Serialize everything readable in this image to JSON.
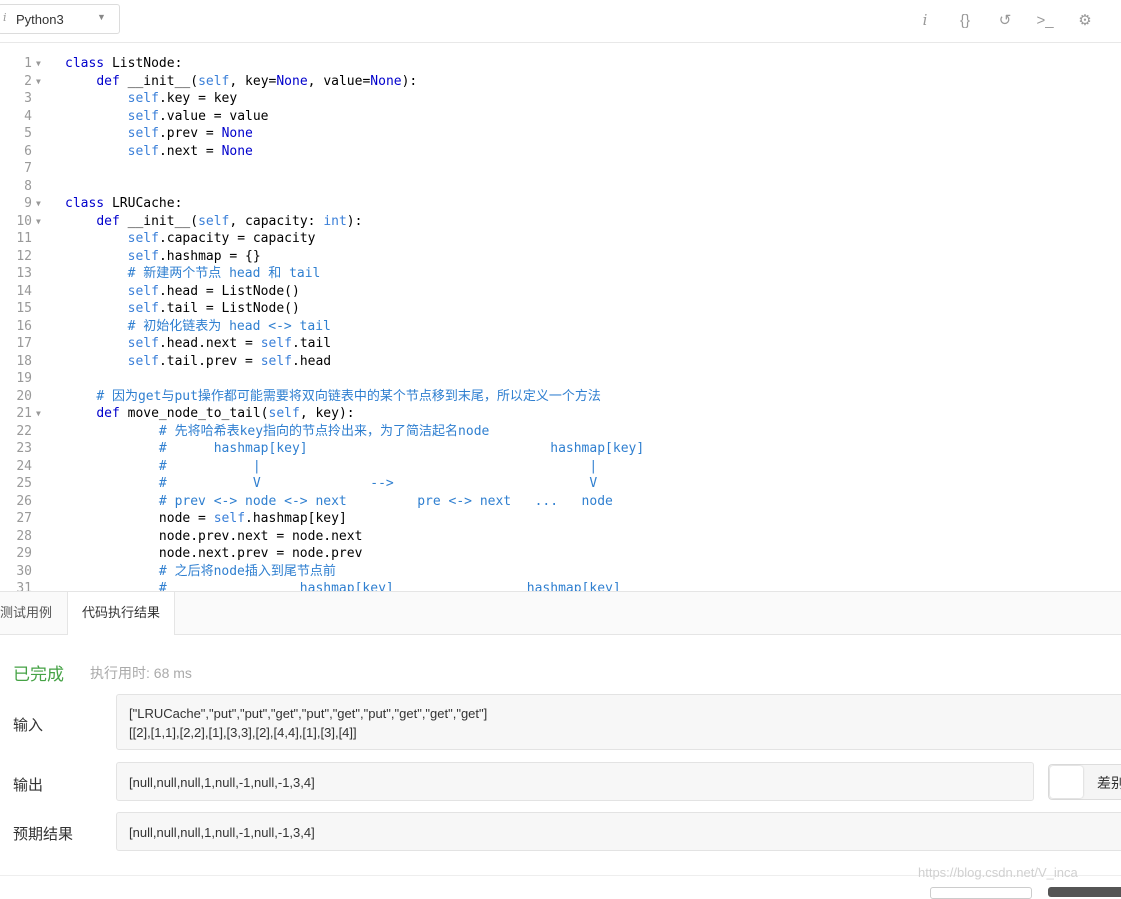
{
  "toolbar": {
    "language": "Python3",
    "icons": [
      "info-icon",
      "braces-icon",
      "reset-icon",
      "console-icon",
      "settings-icon"
    ],
    "icon_glyphs": [
      "i",
      "{}",
      "↺",
      ">_",
      "⚙"
    ]
  },
  "editor": {
    "lines": [
      {
        "n": "1",
        "fold": true,
        "t": [
          [
            "kw",
            "class"
          ],
          [
            "n",
            " ListNode:"
          ]
        ]
      },
      {
        "n": "2",
        "fold": true,
        "t": [
          [
            "n",
            "    "
          ],
          [
            "kw",
            "def"
          ],
          [
            "n",
            " __init__("
          ],
          [
            "sf",
            "self"
          ],
          [
            "n",
            ", key="
          ],
          [
            "kw",
            "None"
          ],
          [
            "n",
            ", value="
          ],
          [
            "kw",
            "None"
          ],
          [
            "n",
            "):"
          ]
        ]
      },
      {
        "n": "3",
        "t": [
          [
            "n",
            "        "
          ],
          [
            "sf",
            "self"
          ],
          [
            "n",
            ".key = key"
          ]
        ]
      },
      {
        "n": "4",
        "t": [
          [
            "n",
            "        "
          ],
          [
            "sf",
            "self"
          ],
          [
            "n",
            ".value = value"
          ]
        ]
      },
      {
        "n": "5",
        "t": [
          [
            "n",
            "        "
          ],
          [
            "sf",
            "self"
          ],
          [
            "n",
            ".prev = "
          ],
          [
            "kw",
            "None"
          ]
        ]
      },
      {
        "n": "6",
        "t": [
          [
            "n",
            "        "
          ],
          [
            "sf",
            "self"
          ],
          [
            "n",
            ".next = "
          ],
          [
            "kw",
            "None"
          ]
        ]
      },
      {
        "n": "7",
        "t": []
      },
      {
        "n": "8",
        "t": []
      },
      {
        "n": "9",
        "fold": true,
        "t": [
          [
            "kw",
            "class"
          ],
          [
            "n",
            " LRUCache:"
          ]
        ]
      },
      {
        "n": "10",
        "fold": true,
        "t": [
          [
            "n",
            "    "
          ],
          [
            "kw",
            "def"
          ],
          [
            "n",
            " __init__("
          ],
          [
            "sf",
            "self"
          ],
          [
            "n",
            ", capacity: "
          ],
          [
            "sf",
            "int"
          ],
          [
            "n",
            "):"
          ]
        ]
      },
      {
        "n": "11",
        "t": [
          [
            "n",
            "        "
          ],
          [
            "sf",
            "self"
          ],
          [
            "n",
            ".capacity = capacity"
          ]
        ]
      },
      {
        "n": "12",
        "t": [
          [
            "n",
            "        "
          ],
          [
            "sf",
            "self"
          ],
          [
            "n",
            ".hashmap = {}"
          ]
        ]
      },
      {
        "n": "13",
        "t": [
          [
            "n",
            "        "
          ],
          [
            "cm",
            "# 新建两个节点 head 和 tail"
          ]
        ]
      },
      {
        "n": "14",
        "t": [
          [
            "n",
            "        "
          ],
          [
            "sf",
            "self"
          ],
          [
            "n",
            ".head = ListNode()"
          ]
        ]
      },
      {
        "n": "15",
        "t": [
          [
            "n",
            "        "
          ],
          [
            "sf",
            "self"
          ],
          [
            "n",
            ".tail = ListNode()"
          ]
        ]
      },
      {
        "n": "16",
        "t": [
          [
            "n",
            "        "
          ],
          [
            "cm",
            "# 初始化链表为 head <-> tail"
          ]
        ]
      },
      {
        "n": "17",
        "t": [
          [
            "n",
            "        "
          ],
          [
            "sf",
            "self"
          ],
          [
            "n",
            ".head.next = "
          ],
          [
            "sf",
            "self"
          ],
          [
            "n",
            ".tail"
          ]
        ]
      },
      {
        "n": "18",
        "t": [
          [
            "n",
            "        "
          ],
          [
            "sf",
            "self"
          ],
          [
            "n",
            ".tail.prev = "
          ],
          [
            "sf",
            "self"
          ],
          [
            "n",
            ".head"
          ]
        ]
      },
      {
        "n": "19",
        "t": []
      },
      {
        "n": "20",
        "t": [
          [
            "n",
            "    "
          ],
          [
            "cm",
            "# 因为get与put操作都可能需要将双向链表中的某个节点移到末尾，所以定义一个方法"
          ]
        ]
      },
      {
        "n": "21",
        "fold": true,
        "t": [
          [
            "n",
            "    "
          ],
          [
            "kw",
            "def"
          ],
          [
            "n",
            " move_node_to_tail("
          ],
          [
            "sf",
            "self"
          ],
          [
            "n",
            ", key):"
          ]
        ]
      },
      {
        "n": "22",
        "t": [
          [
            "n",
            "            "
          ],
          [
            "cm",
            "# 先将哈希表key指向的节点拎出来，为了简洁起名node"
          ]
        ]
      },
      {
        "n": "23",
        "t": [
          [
            "n",
            "            "
          ],
          [
            "cm",
            "#      hashmap[key]                               hashmap[key]"
          ]
        ]
      },
      {
        "n": "24",
        "t": [
          [
            "n",
            "            "
          ],
          [
            "cm",
            "#           |                                          |"
          ]
        ]
      },
      {
        "n": "25",
        "t": [
          [
            "n",
            "            "
          ],
          [
            "cm",
            "#           V              -->                         V"
          ]
        ]
      },
      {
        "n": "26",
        "t": [
          [
            "n",
            "            "
          ],
          [
            "cm",
            "# prev <-> node <-> next         pre <-> next   ...   node"
          ]
        ]
      },
      {
        "n": "27",
        "t": [
          [
            "n",
            "            node = "
          ],
          [
            "sf",
            "self"
          ],
          [
            "n",
            ".hashmap[key]"
          ]
        ]
      },
      {
        "n": "28",
        "t": [
          [
            "n",
            "            node.prev.next = node.next"
          ]
        ]
      },
      {
        "n": "29",
        "t": [
          [
            "n",
            "            node.next.prev = node.prev"
          ]
        ]
      },
      {
        "n": "30",
        "t": [
          [
            "n",
            "            "
          ],
          [
            "cm",
            "# 之后将node插入到尾节点前"
          ]
        ]
      },
      {
        "n": "31",
        "t": [
          [
            "n",
            "            "
          ],
          [
            "cm",
            "#                 hashmap[key]                 hashmap[key]"
          ]
        ]
      }
    ]
  },
  "tabs": [
    "测试用例",
    "代码执行结果"
  ],
  "result": {
    "status": "已完成",
    "exec_time": "执行用时: 68 ms",
    "input_label": "输入",
    "input_line1": "[\"LRUCache\",\"put\",\"put\",\"get\",\"put\",\"get\",\"put\",\"get\",\"get\",\"get\"]",
    "input_line2": "[[2],[1,1],[2,2],[1],[3,3],[2],[4,4],[1],[3],[4]]",
    "output_label": "输出",
    "output_value": "[null,null,null,1,null,-1,null,-1,3,4]",
    "diff_label": "差别",
    "expected_label": "预期结果",
    "expected_value": "[null,null,null,1,null,-1,null,-1,3,4]"
  },
  "watermark": "https://blog.csdn.net/V_inca"
}
